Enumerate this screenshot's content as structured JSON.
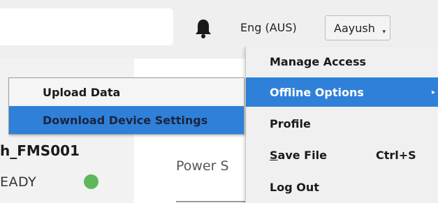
{
  "header": {
    "language": "Eng (AUS)",
    "user": "Aayush",
    "user_caret": "▾"
  },
  "device": {
    "name": "h_FMS001",
    "status": "EADY",
    "status_color": "#5cb85c"
  },
  "content": {
    "power_label": "Power S"
  },
  "menu": {
    "items": [
      {
        "label": "Manage Access"
      },
      {
        "label": "Offline Options",
        "arrow": "▸"
      },
      {
        "label": "Profile"
      },
      {
        "label_mnemonic": "S",
        "label_rest": "ave File",
        "shortcut": "Ctrl+S"
      },
      {
        "label": "Log Out"
      }
    ]
  },
  "submenu": {
    "items": [
      {
        "label": "Upload Data"
      },
      {
        "label": "Download Device Settings"
      }
    ]
  },
  "colors": {
    "accent": "#2f80d8",
    "menu_bg": "#f0f0f0",
    "topbar_bg": "#efefef"
  },
  "icons": {
    "bell": "bell-icon",
    "caret": "chevron-down-icon",
    "submenu_arrow": "chevron-right-icon"
  }
}
